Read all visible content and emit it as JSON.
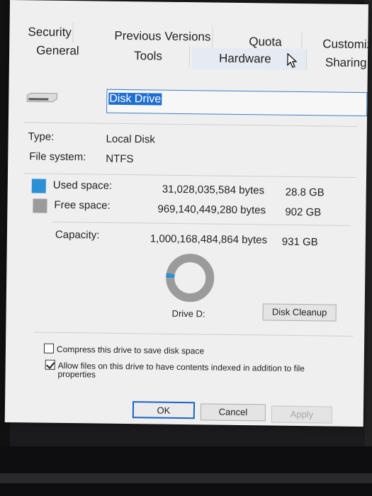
{
  "tabs_row1": [
    {
      "label": "Security"
    },
    {
      "label": "Previous Versions"
    },
    {
      "label": "Quota"
    },
    {
      "label": "Customize"
    }
  ],
  "tabs_row2": [
    {
      "label": "General"
    },
    {
      "label": "Tools"
    },
    {
      "label": "Hardware"
    },
    {
      "label": "Sharing"
    }
  ],
  "drive_name": "Disk Drive",
  "type": {
    "label": "Type:",
    "value": "Local Disk"
  },
  "filesystem": {
    "label": "File system:",
    "value": "NTFS"
  },
  "used": {
    "label": "Used space:",
    "bytes": "31,028,035,584 bytes",
    "size": "28.8 GB",
    "color": "#2d8fd5"
  },
  "free": {
    "label": "Free space:",
    "bytes": "969,140,449,280 bytes",
    "size": "902 GB",
    "color": "#9b9b9b"
  },
  "capacity": {
    "label": "Capacity:",
    "bytes": "1,000,168,484,864 bytes",
    "size": "931 GB"
  },
  "used_fraction": 0.031,
  "drive_label": "Drive D:",
  "disk_cleanup_label": "Disk Cleanup",
  "compress_label": "Compress this drive to save disk space",
  "compress_checked": false,
  "index_label_line1": "Allow files on this drive to have contents indexed in addition to file",
  "index_label_line2": "properties",
  "index_checked": true,
  "buttons": {
    "ok": "OK",
    "cancel": "Cancel",
    "apply": "Apply"
  }
}
